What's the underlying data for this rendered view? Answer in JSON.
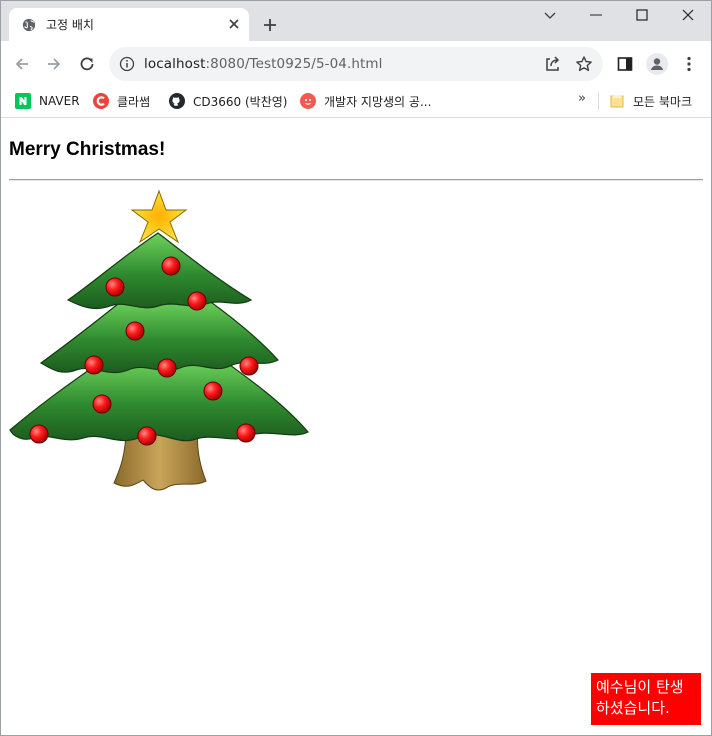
{
  "browser": {
    "tab": {
      "title": "고정 배치"
    },
    "address_bar": {
      "host": "localhost",
      "path": ":8080/Test0925/5-04.html"
    },
    "bookmarks": [
      {
        "label": "NAVER",
        "icon": "naver-icon",
        "color": "#03c75a"
      },
      {
        "label": "클라썸",
        "icon": "classum-icon",
        "color": "#e8453c"
      },
      {
        "label": "CD3660 (박찬영)",
        "icon": "github-icon",
        "color": "#24292f"
      },
      {
        "label": "개발자 지망생의 공...",
        "icon": "blog-icon",
        "color": "#f05a4f"
      }
    ],
    "bookmarks_more": "»",
    "bookmarks_folder": {
      "label": "모든 북마크",
      "icon": "folder-icon"
    }
  },
  "page": {
    "heading": "Merry Christmas!",
    "fixed_note": "예수님이 탄생하셨습니다.",
    "fixed_note_color": "#ff0000"
  }
}
